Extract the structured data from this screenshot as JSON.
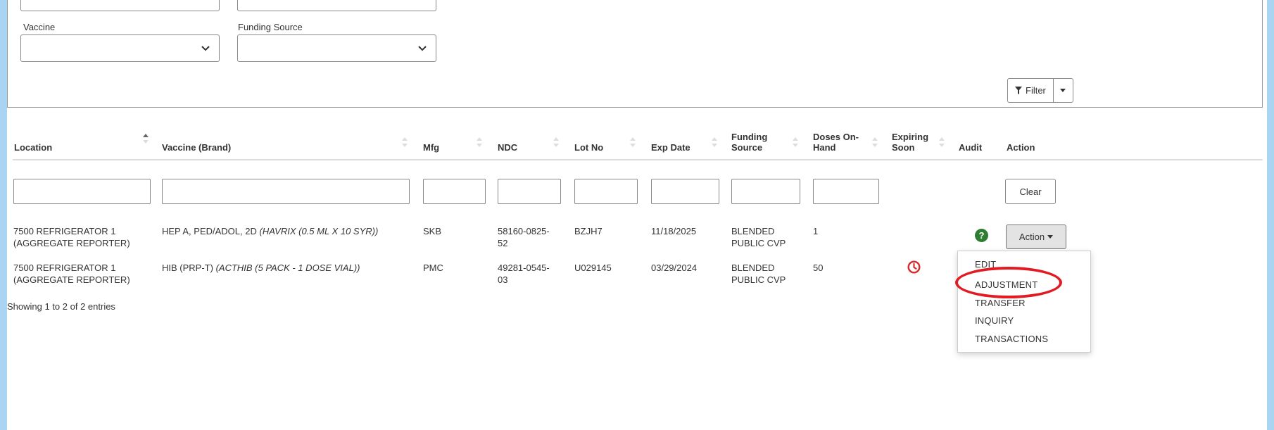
{
  "filters": {
    "vaccine_label": "Vaccine",
    "vaccine_value": "",
    "funding_label": "Funding Source",
    "funding_value": "",
    "filter_button": "Filter"
  },
  "table": {
    "headers": {
      "location": "Location",
      "vaccine": "Vaccine (Brand)",
      "mfg": "Mfg",
      "ndc": "NDC",
      "lot": "Lot No",
      "exp": "Exp Date",
      "funding_1": "Funding",
      "funding_2": "Source",
      "doses_1": "Doses On-",
      "doses_2": "Hand",
      "expiring_1": "Expiring",
      "expiring_2": "Soon",
      "audit": "Audit",
      "action": "Action"
    },
    "clear_button": "Clear",
    "rows": [
      {
        "location_1": "7500 REFRIGERATOR 1",
        "location_2": "(AGGREGATE REPORTER)",
        "vaccine": "HEP A, PED/ADOL, 2D ",
        "brand": "(HAVRIX (0.5 ML X 10 SYR))",
        "mfg": "SKB",
        "ndc_1": "58160-0825-",
        "ndc_2": "52",
        "lot": "BZJH7",
        "exp": "11/18/2025",
        "funding_1": "BLENDED",
        "funding_2": "PUBLIC CVP",
        "doses": "1",
        "action_button": "Action"
      },
      {
        "location_1": "7500 REFRIGERATOR 1",
        "location_2": "(AGGREGATE REPORTER)",
        "vaccine": "HIB (PRP-T) ",
        "brand": "(ACTHIB (5 PACK - 1 DOSE VIAL))",
        "mfg": "PMC",
        "ndc_1": "49281-0545-",
        "ndc_2": "03",
        "lot": "U029145",
        "exp": "03/29/2024",
        "funding_1": "BLENDED",
        "funding_2": "PUBLIC CVP",
        "doses": "50"
      }
    ],
    "info": "Showing 1 to 2 of 2 entries"
  },
  "action_menu": {
    "items": [
      "EDIT",
      "ADJUSTMENT",
      "TRANSFER",
      "INQUIRY",
      "TRANSACTIONS"
    ]
  },
  "colors": {
    "background": "#a9d5f2",
    "audit_icon": "#2e7d32",
    "expiring_icon": "#d9292b",
    "highlight": "#e21b23"
  }
}
